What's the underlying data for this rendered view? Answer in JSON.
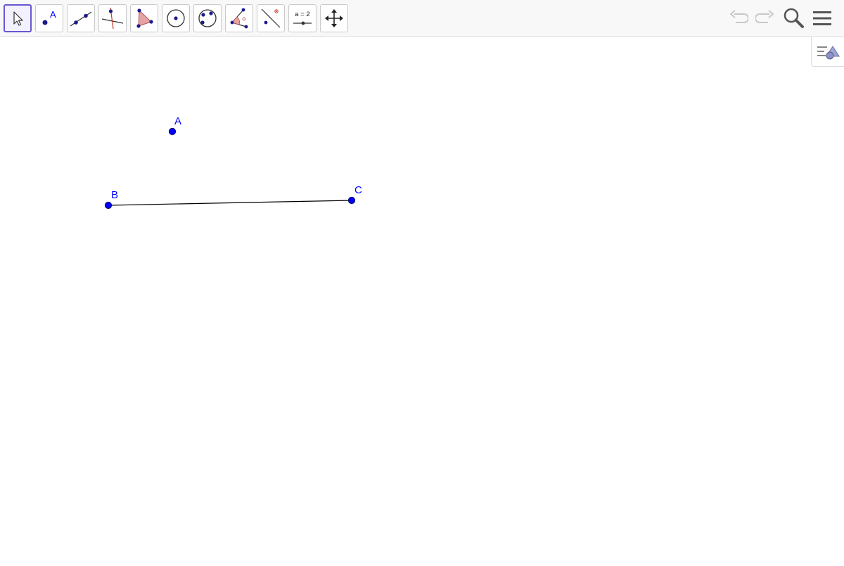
{
  "toolbar": {
    "tools": [
      {
        "name": "move-tool",
        "selected": true
      },
      {
        "name": "point-tool",
        "icon_text": "A"
      },
      {
        "name": "line-tool"
      },
      {
        "name": "perpendicular-line-tool"
      },
      {
        "name": "polygon-tool"
      },
      {
        "name": "circle-center-point-tool"
      },
      {
        "name": "circle-three-points-tool"
      },
      {
        "name": "angle-tool"
      },
      {
        "name": "reflect-about-line-tool"
      },
      {
        "name": "slider-tool",
        "icon_text": "a = 2"
      },
      {
        "name": "move-graphics-view-tool"
      }
    ],
    "controls": [
      "undo-icon",
      "redo-icon",
      "search-icon",
      "menu-icon"
    ]
  },
  "construction": {
    "points": [
      {
        "label": "A"
      },
      {
        "label": "B"
      },
      {
        "label": "C"
      }
    ],
    "segments": [
      {
        "from": "B",
        "to": "C"
      }
    ]
  },
  "colors": {
    "point_fill": "#0000ff",
    "label": "#0000ff",
    "segment": "#000000",
    "selected_tool_border": "#6557d2",
    "polygon_fill": "#e6a3a3"
  }
}
